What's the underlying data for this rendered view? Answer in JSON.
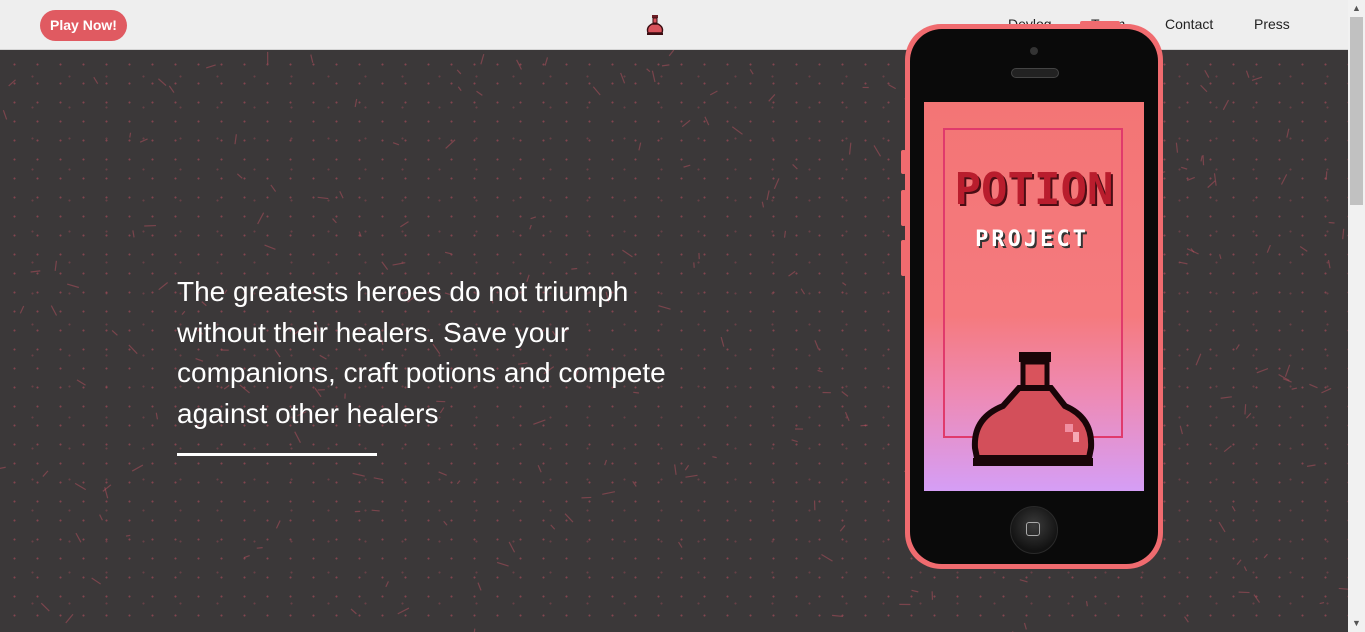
{
  "navbar": {
    "play_label": "Play Now!",
    "logo_icon": "potion-flask-icon",
    "links": [
      "Devlog",
      "Team",
      "Contact",
      "Press"
    ]
  },
  "hero": {
    "tagline": "The greatests heroes do not triumph without their healers. Save your companions, craft potions and compete against other healers"
  },
  "phone_screen": {
    "title": "POTION",
    "subtitle": "PROJECT",
    "artwork_icon": "potion-flask-icon"
  },
  "colors": {
    "accent": "#e05a61",
    "phone_body": "#f06b6f",
    "background": "#3b3839",
    "navbar": "#eeeeee"
  }
}
